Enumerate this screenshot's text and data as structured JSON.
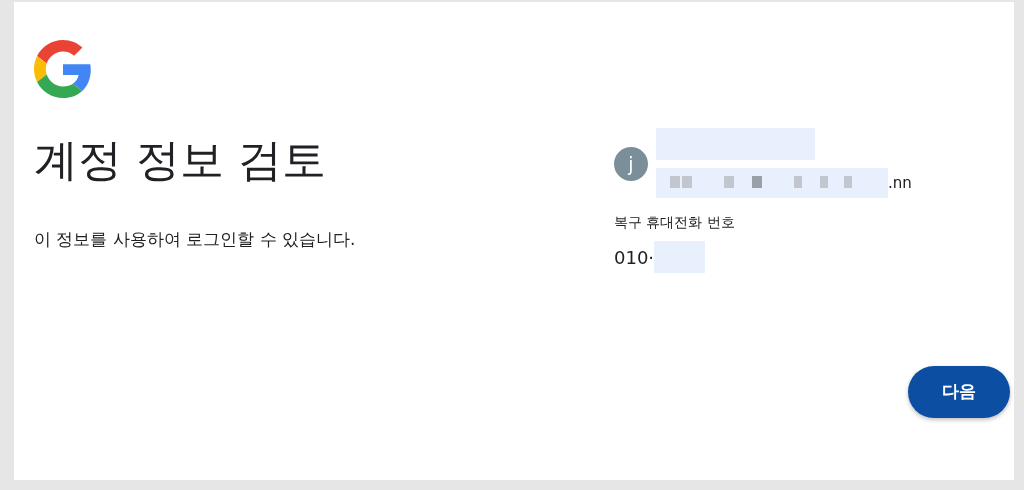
{
  "heading": "계정 정보 검토",
  "description": "이 정보를 사용하여 로그인할 수 있습니다.",
  "account": {
    "avatar_letter": "j",
    "email_suffix": ".nn"
  },
  "recovery_phone": {
    "label": "복구 휴대전화 번호",
    "value_prefix": "010·"
  },
  "buttons": [
    {
      "label": "다음",
      "kind": "primary"
    }
  ]
}
